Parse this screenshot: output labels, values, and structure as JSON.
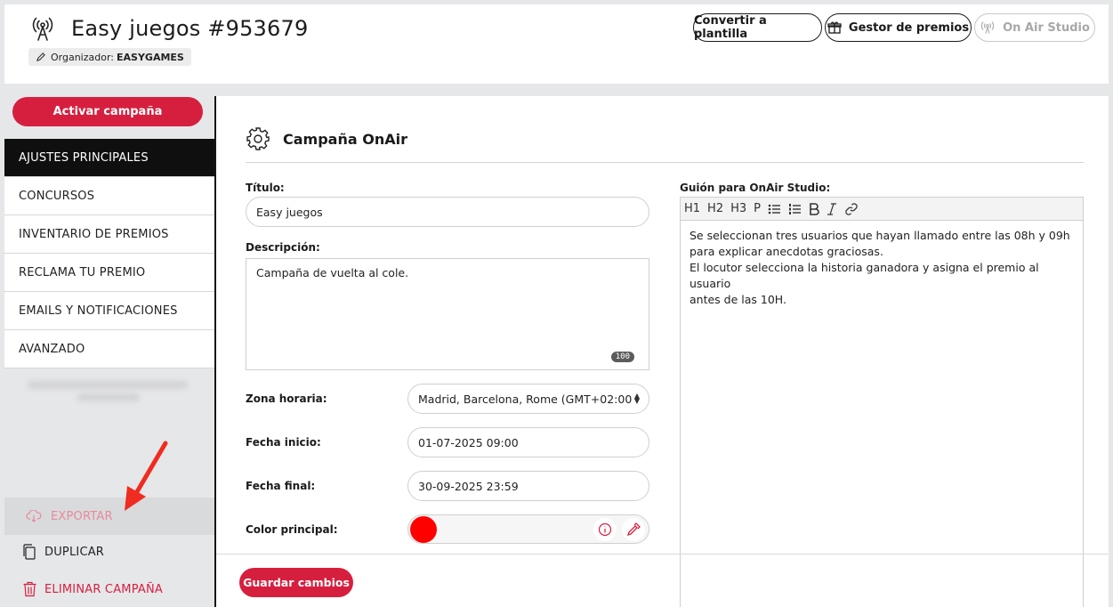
{
  "header": {
    "title": "Easy juegos #953679",
    "organizer_label": "Organizador:",
    "organizer_value": "EASYGAMES",
    "buttons": {
      "template": "Convertir a plantilla",
      "prizes": "Gestor de premios",
      "onair": "On Air Studio"
    }
  },
  "sidebar": {
    "activate": "Activar campaña",
    "items": [
      {
        "label": "AJUSTES PRINCIPALES"
      },
      {
        "label": "CONCURSOS"
      },
      {
        "label": "INVENTARIO DE PREMIOS"
      },
      {
        "label": "RECLAMA TU PREMIO"
      },
      {
        "label": "EMAILS Y NOTIFICACIONES"
      },
      {
        "label": "AVANZADO"
      }
    ],
    "export": "EXPORTAR",
    "duplicate": "DUPLICAR",
    "delete": "ELIMINAR CAMPAÑA"
  },
  "main": {
    "section_title": "Campaña OnAir",
    "title_label": "Título:",
    "title_value": "Easy juegos",
    "desc_label": "Descripción:",
    "desc_value": "Campaña de vuelta al cole.",
    "desc_counter": "100",
    "tz_label": "Zona horaria:",
    "tz_value": "Madrid, Barcelona, Rome (GMT+02:00",
    "start_label": "Fecha inicio:",
    "start_value": "01-07-2025 09:00",
    "end_label": "Fecha final:",
    "end_value": "30-09-2025 23:59",
    "color_label": "Color principal:",
    "color_value": "#ff0000",
    "script_label": "Guión para OnAir Studio:",
    "toolbar": [
      "H1",
      "H2",
      "H3",
      "P"
    ],
    "script_line1": "Se seleccionan tres usuarios que hayan llamado entre las 08h y 09h",
    "script_line2": "para explicar anecdotas graciosas.",
    "script_line3": "El locutor selecciona la historia ganadora y asigna el premio al usuario",
    "script_line4": "antes de las 10H.",
    "save": "Guardar cambios"
  },
  "colors": {
    "accent": "#d61f3e",
    "nav_active": "#0f0f0f"
  }
}
